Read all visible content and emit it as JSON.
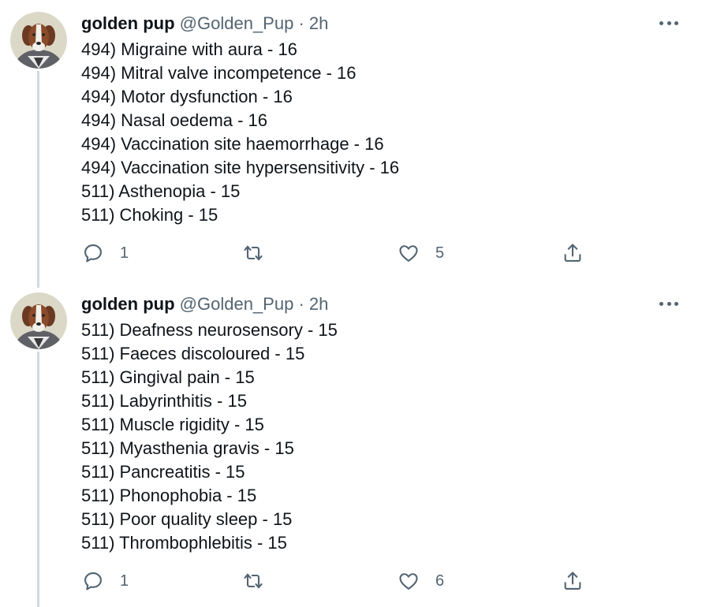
{
  "tweets": [
    {
      "author": "golden pup",
      "handle": "@Golden_Pup",
      "separator": "·",
      "time": "2h",
      "lines": [
        "494) Migraine with aura - 16",
        "494) Mitral valve incompetence - 16",
        "494) Motor dysfunction - 16",
        "494) Nasal oedema - 16",
        "494) Vaccination site haemorrhage - 16",
        "494) Vaccination site hypersensitivity - 16",
        "511) Asthenopia - 15",
        "511) Choking - 15"
      ],
      "reply_count": "1",
      "like_count": "5"
    },
    {
      "author": "golden pup",
      "handle": "@Golden_Pup",
      "separator": "·",
      "time": "2h",
      "lines": [
        "511) Deafness neurosensory - 15",
        "511) Faeces discoloured - 15",
        "511) Gingival pain - 15",
        "511) Labyrinthitis - 15",
        "511) Muscle rigidity - 15",
        "511) Myasthenia gravis - 15",
        "511) Pancreatitis - 15",
        "511) Phonophobia - 15",
        "511) Poor quality sleep - 15",
        "511) Thrombophlebitis - 15"
      ],
      "reply_count": "1",
      "like_count": "6"
    }
  ],
  "icons": {
    "more": "more-dots-icon",
    "reply": "reply-bubble-icon",
    "retweet": "retweet-arrows-icon",
    "like": "heart-icon",
    "share": "share-upload-icon"
  },
  "colors": {
    "text": "#0f1419",
    "secondary": "#536471",
    "thread_line": "#cfd9de"
  }
}
